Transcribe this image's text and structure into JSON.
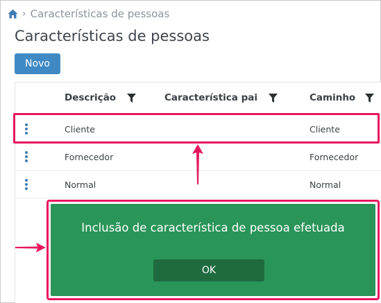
{
  "breadcrumb": {
    "home_icon": "home-icon",
    "separator_icon": "chevron-right-icon",
    "current": "Características de pessoas"
  },
  "page": {
    "title": "Características de pessoas",
    "new_button": "Novo"
  },
  "grid": {
    "columns": [
      {
        "label": "Descrição",
        "filter_icon": "filter-icon"
      },
      {
        "label": "Característica pai",
        "filter_icon": "filter-icon"
      },
      {
        "label": "Caminho",
        "filter_icon": "filter-icon"
      }
    ],
    "rows": [
      {
        "descricao": "Cliente",
        "caracteristica_pai": "",
        "caminho": "Cliente"
      },
      {
        "descricao": "Fornecedor",
        "caracteristica_pai": "",
        "caminho": "Fornecedor"
      },
      {
        "descricao": "Normal",
        "caracteristica_pai": "",
        "caminho": "Normal"
      }
    ]
  },
  "toast": {
    "message": "Inclusão de característica de pessoa efetuada",
    "ok_label": "OK"
  },
  "colors": {
    "accent": "#3f8ac4",
    "toast_bg": "#2a9559",
    "highlight": "#e6175f"
  }
}
